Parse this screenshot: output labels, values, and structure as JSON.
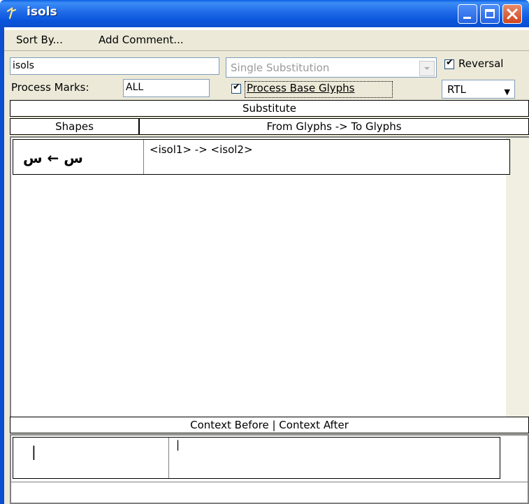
{
  "window": {
    "title": "isols"
  },
  "menu": [
    {
      "label": "Sort By..."
    },
    {
      "label": "Add Comment..."
    }
  ],
  "row1": {
    "lookup_name": "isols",
    "lookup_type": "Single Substitution",
    "reversal_label": "Reversal",
    "reversal_checked": true
  },
  "row2": {
    "process_marks_label": "Process Marks:",
    "process_marks_value": "ALL",
    "process_base_glyphs_label": "Process Base Glyphs",
    "process_base_glyphs_checked": true,
    "direction": "RTL"
  },
  "substitute_header": "Substitute",
  "columns": {
    "shapes": "Shapes",
    "glyphs": "From Glyphs -> To Glyphs"
  },
  "rules": [
    {
      "shape": "ﺱ ← ﺱ",
      "glyphs": "<isol1> -> <isol2>"
    }
  ],
  "context_header": "Context Before | Context After",
  "context_row": {
    "before": "|",
    "after": "|"
  }
}
